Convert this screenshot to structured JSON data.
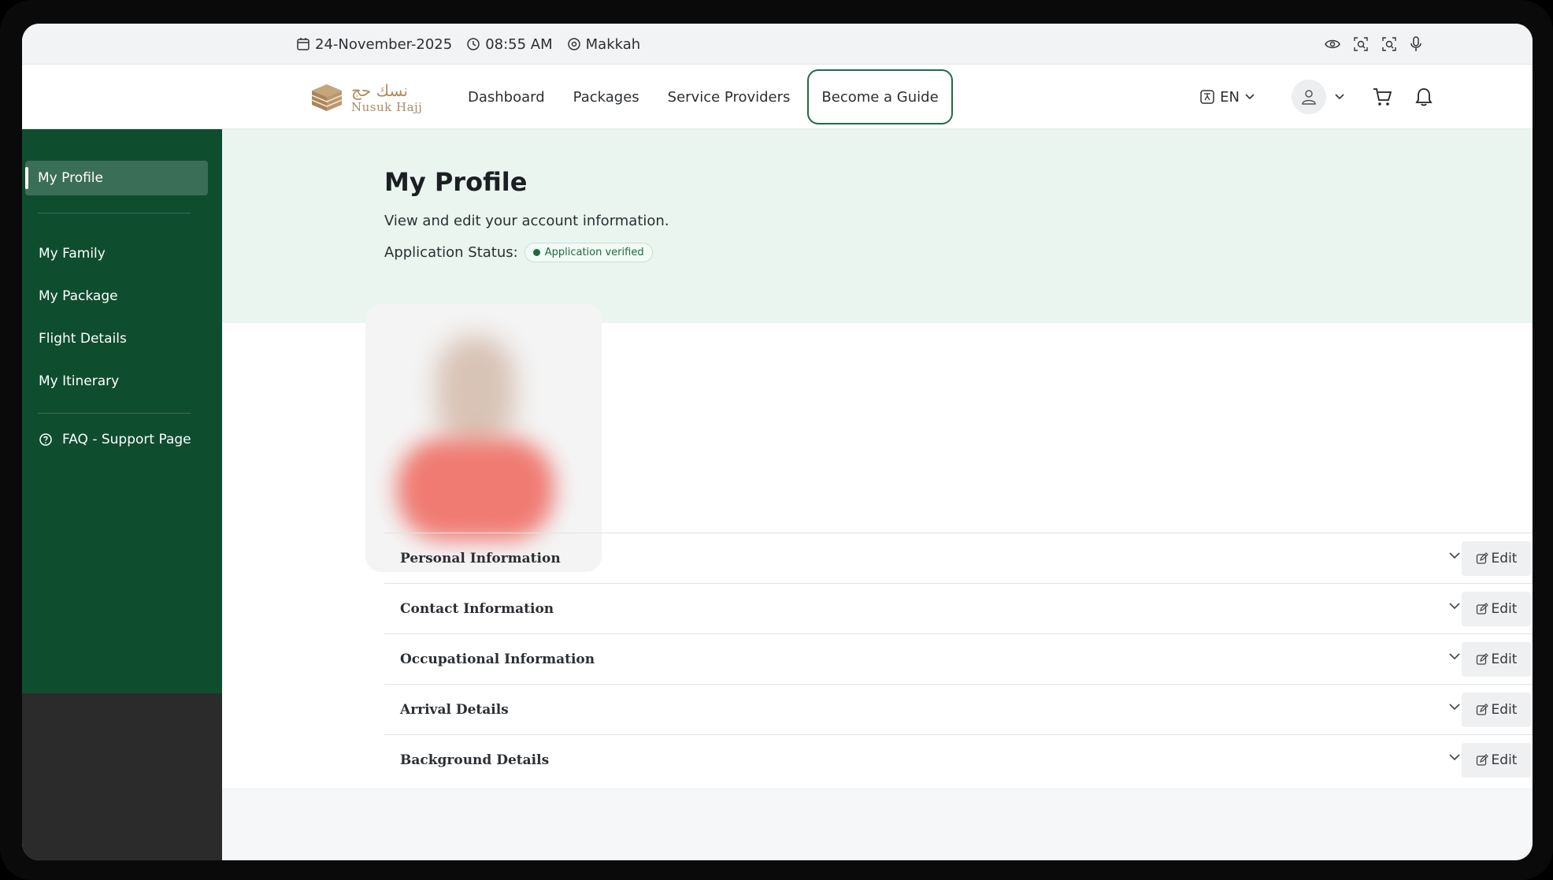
{
  "infobar": {
    "date": "24-November-2025",
    "time": "08:55 AM",
    "location": "Makkah",
    "icons": [
      "eye-icon",
      "zoom-in-icon",
      "zoom-out-icon",
      "microphone-icon"
    ]
  },
  "navbar": {
    "logo_ar": "نسك حج",
    "logo_en": "Nusuk Hajj",
    "links": [
      "Dashboard",
      "Packages",
      "Service Providers",
      "Become a Guide"
    ],
    "language": "EN"
  },
  "sidebar": {
    "active": "My Profile",
    "items": [
      "My Family",
      "My Package",
      "Flight Details",
      "My Itinerary"
    ],
    "faq": "FAQ - Support Page"
  },
  "profile": {
    "title": "My Profile",
    "subtitle": "View and edit your account information.",
    "status_label": "Application Status:",
    "status_badge": "Application verified"
  },
  "sections": [
    {
      "title": "Personal Information",
      "edit": "Edit"
    },
    {
      "title": "Contact Information",
      "edit": "Edit"
    },
    {
      "title": "Occupational Information",
      "edit": "Edit"
    },
    {
      "title": "Arrival Details",
      "edit": "Edit"
    },
    {
      "title": "Background Details",
      "edit": "Edit"
    }
  ],
  "colors": {
    "brand_green": "#0f4d2f",
    "hero_bg": "#e9f5ee",
    "accent_gold": "#b08a5a"
  }
}
